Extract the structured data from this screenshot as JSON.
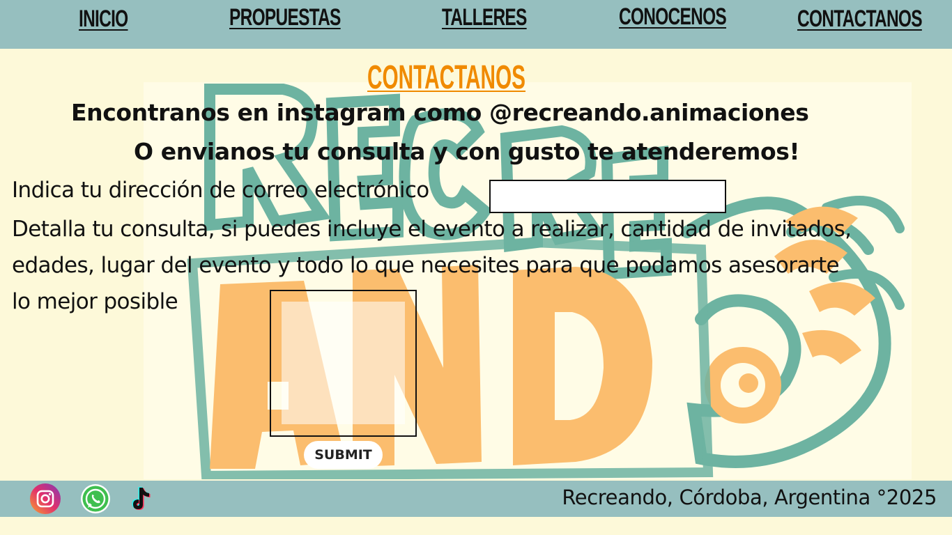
{
  "nav": {
    "items": [
      {
        "label": "INICIO"
      },
      {
        "label": "PROPUESTAS"
      },
      {
        "label": "TALLERES"
      },
      {
        "label": "CONOCENOS"
      },
      {
        "label": "CONTACTANOS"
      }
    ]
  },
  "page": {
    "title": "CONTACTANOS",
    "heading_instagram": "Encontranos en instagram como @recreando.animaciones",
    "heading_consulta": "O envianos tu consulta y con gusto te atenderemos!",
    "email_label": "Indica tu dirección de correo electrónico",
    "email_value": "",
    "query_label_lines": [
      "Detalla tu consulta, si puedes incluye el evento a realizar, cantidad de invitados,",
      "edades, lugar del evento y todo lo que necesites para que podamos asesorarte",
      "lo mejor posible"
    ],
    "query_value": "",
    "submit_label": "SUBMIT"
  },
  "footer": {
    "text": "Recreando, Córdoba, Argentina °2025",
    "social_icons": [
      "instagram-icon",
      "whatsapp-icon",
      "tiktok-icon"
    ]
  },
  "colors": {
    "page_background": "#fdf9d9",
    "bar_background": "#96bfbf",
    "title_accent": "#f08a00",
    "logo_teal": "#6db3a1",
    "logo_orange": "#fbbd6e"
  }
}
